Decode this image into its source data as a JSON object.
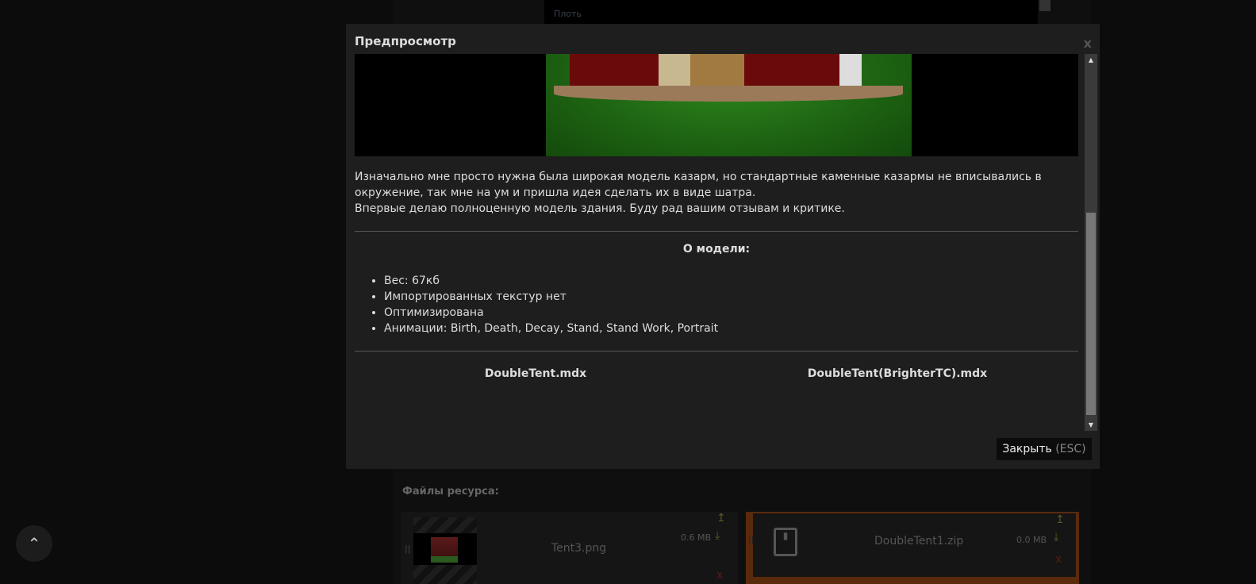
{
  "background": {
    "top_field": "Плоть",
    "files_label": "Файлы ресурса:",
    "files": [
      {
        "name": "Tent3.png",
        "size": "0.6 MB"
      },
      {
        "name": "DoubleTent1.zip",
        "size": "0.0 MB"
      }
    ]
  },
  "modal": {
    "title": "Предпросмотр",
    "close_x": "x",
    "description": [
      "Изначально мне просто нужна была широкая модель казарм, но стандартные каменные казармы не вписывались в окружение, так мне на ум и пришла идея сделать их в виде шатра.",
      "Впервые делаю полноценную модель здания. Буду рад вашим отзывам и критике."
    ],
    "about_title": "О модели:",
    "about_items": [
      "Вес: 67кб",
      "Импортированных текстур нет",
      "Оптимизирована",
      "Анимации: Birth, Death, Decay, Stand, Stand Work, Portrait"
    ],
    "downloads": [
      "DoubleTent.mdx",
      "DoubleTent(BrighterTC).mdx"
    ],
    "close_label": "Закрыть",
    "close_hint": "(ESC)"
  }
}
